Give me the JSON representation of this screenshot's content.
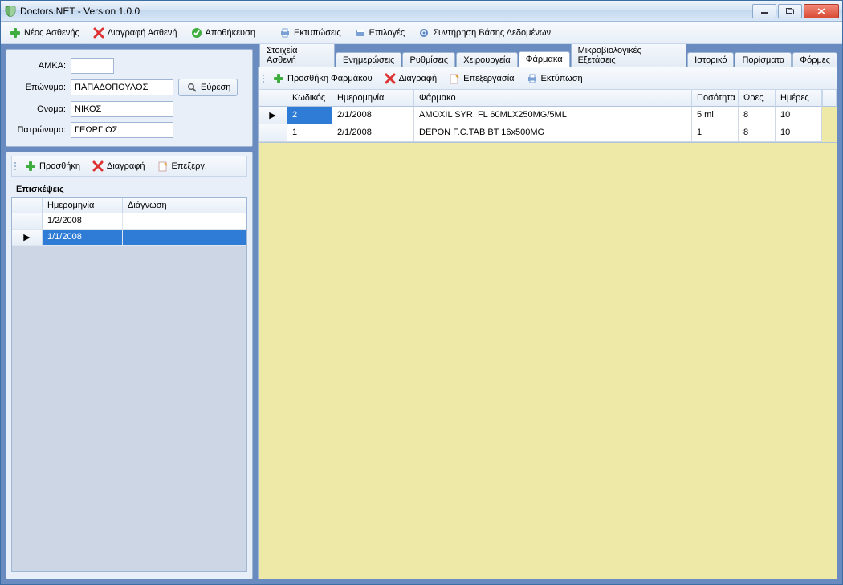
{
  "window": {
    "title": "Doctors.NET - Version 1.0.0"
  },
  "toolbar": {
    "new_patient": "Νέος Ασθενής",
    "delete_patient": "Διαγραφή Ασθενή",
    "save": "Αποθήκευση",
    "print": "Εκτυπώσεις",
    "options": "Επιλογές",
    "db_maint": "Συντήρηση Βάσης Δεδομένων"
  },
  "patient_form": {
    "amka_label": "ΑΜΚΑ:",
    "amka_value": "",
    "surname_label": "Επώνυμο:",
    "surname_value": "ΠΑΠΑΔΟΠΟΥΛΟΣ",
    "name_label": "Ονομα:",
    "name_value": "ΝΙΚΟΣ",
    "father_label": "Πατρώνυμο:",
    "father_value": "ΓΕΩΡΓΙΟΣ",
    "search_btn": "Εύρεση"
  },
  "visits_toolbar": {
    "add": "Προσθήκη",
    "delete": "Διαγραφή",
    "edit": "Επεξεργ."
  },
  "visits": {
    "title": "Επισκέψεις",
    "columns": {
      "date": "Ημερομηνία",
      "diagnosis": "Διάγνωση"
    },
    "rows": [
      {
        "date": "1/2/2008",
        "diagnosis": ""
      },
      {
        "date": "1/1/2008",
        "diagnosis": ""
      }
    ],
    "selected_index": 1
  },
  "tabs": {
    "items": [
      "Στοιχεία Ασθενή",
      "Ενημερώσεις",
      "Ρυθμίσεις",
      "Χειρουργεία",
      "Φάρμακα",
      "Μικροβιολογικές Εξετάσεις",
      "Ιστορικό",
      "Πορίσματα",
      "Φόρμες"
    ],
    "active_index": 4
  },
  "meds_toolbar": {
    "add": "Προσθήκη Φαρμάκου",
    "delete": "Διαγραφή",
    "edit": "Επεξεργασία",
    "print": "Εκτύπωση"
  },
  "meds": {
    "columns": {
      "code": "Κωδικός",
      "date": "Ημερομηνία",
      "drug": "Φάρμακο",
      "qty": "Ποσότητα",
      "hours": "Ωρες",
      "days": "Ημέρες"
    },
    "rows": [
      {
        "code": "2",
        "date": "2/1/2008",
        "drug": "AMOXIL SYR. FL 60MLX250MG/5ML",
        "qty": "5 ml",
        "hours": "8",
        "days": "10"
      },
      {
        "code": "1",
        "date": "2/1/2008",
        "drug": "DEPON F.C.TAB BT 16x500MG",
        "qty": "1",
        "hours": "8",
        "days": "10"
      }
    ],
    "selected_index": 0
  }
}
